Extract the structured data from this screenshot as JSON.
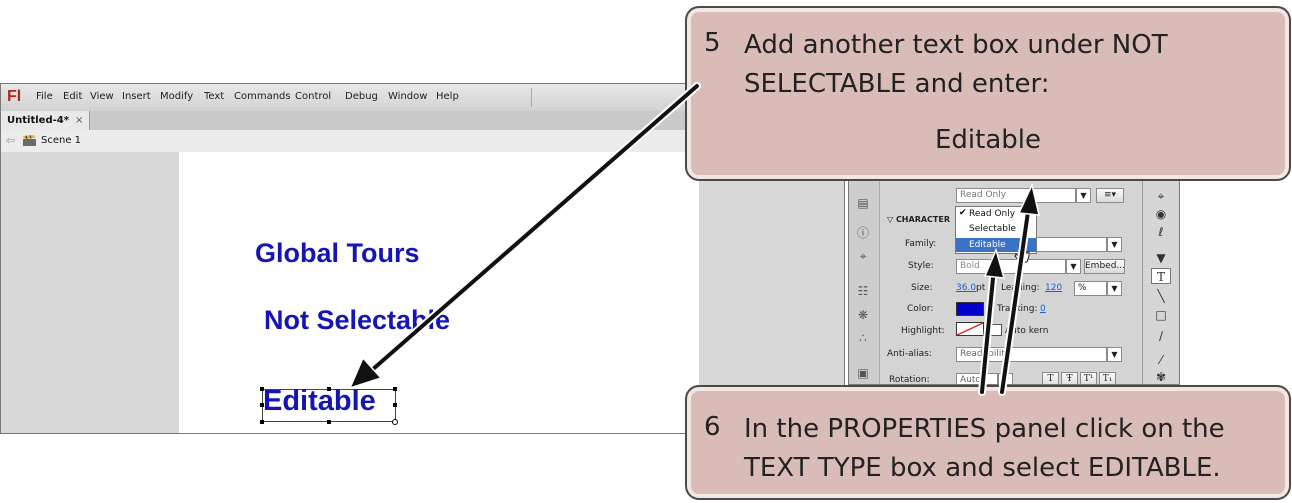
{
  "app": {
    "logo": "Fl",
    "menu": [
      "File",
      "Edit",
      "View",
      "Insert",
      "Modify",
      "Text",
      "Commands",
      "Control",
      "Debug",
      "Window",
      "Help"
    ],
    "doc_tab": "Untitled-4*",
    "doc_tab_close": "×",
    "back_arrow": "⇦",
    "scene": "Scene 1"
  },
  "stage": {
    "text1": "Global Tours",
    "text2": "Not Selectable",
    "text3": "Editable"
  },
  "props": {
    "text_type_value": "Read Only",
    "section_header": "CHARACTER",
    "family_label": "Family:",
    "style_label": "Style:",
    "style_value": "Bold",
    "embed_button": "Embed...",
    "size_label": "Size:",
    "size_value": "36.0",
    "size_unit": "pt",
    "leading_label": "Leading:",
    "leading_value": "120",
    "percent_value": "%",
    "color_label": "Color:",
    "tracking_label": "Tracking:",
    "tracking_value": "0",
    "highlight_label": "Highlight:",
    "autokern_label": "Auto kern",
    "antialias_label": "Anti-alias:",
    "antialias_value": "Readability",
    "rotation_label": "Rotation:",
    "rotation_value": "Auto",
    "text_color": "#0000cc"
  },
  "dropdown": {
    "checkmark": "✔",
    "items": [
      "Read Only",
      "Selectable",
      "Editable"
    ]
  },
  "callouts": {
    "step5_number": "5",
    "step5_line1": "Add another text box under NOT",
    "step5_line2": "SELECTABLE and enter:",
    "step5_value": "Editable",
    "step6_number": "6",
    "step6_line1": "In the PROPERTIES panel click on the",
    "step6_line2": "TEXT TYPE box and select EDITABLE."
  },
  "colors": {
    "callout_fill": "#d9bcb7",
    "stage_text": "#1515b5",
    "highlight_blue": "#3a72c7"
  }
}
